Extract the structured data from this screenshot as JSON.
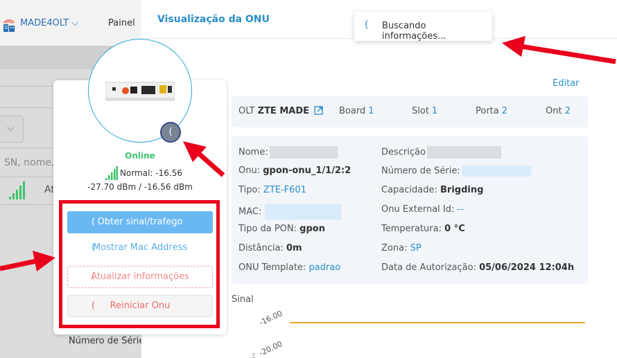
{
  "background": {
    "brand": "MADE4OLT",
    "brand_chevron": "⌵",
    "nav_painel": "Painel",
    "search_placeholder": "SN, nome,",
    "column_at": "At",
    "column_numero_serie": "Número de Série"
  },
  "drawer": {
    "title": "Visualização da ONU",
    "edit_link": "Editar",
    "olt": {
      "olt_label": "OLT",
      "olt_value": "ZTE MADE",
      "board_label": "Board",
      "board_value": "1",
      "slot_label": "Slot",
      "slot_value": "1",
      "porta_label": "Porta",
      "porta_value": "2",
      "ont_label": "Ont",
      "ont_value": "2"
    },
    "info_left": {
      "nome_label": "Nome:",
      "onu_label": "Onu:",
      "onu_value": "gpon-onu_1/1/2:2",
      "tipo_label": "Tipo:",
      "tipo_value": "ZTE-F601",
      "mac_label": "MAC:",
      "tipo_pon_label": "Tipo da PON:",
      "tipo_pon_value": "gpon",
      "distancia_label": "Distância:",
      "distancia_value": "0m",
      "template_label": "ONU Template:",
      "template_value": "padrao"
    },
    "info_right": {
      "descricao_label": "Descrição",
      "serie_label": "Número de Série:",
      "capacidade_label": "Capacidade:",
      "capacidade_value": "Brigding",
      "external_id_label": "Onu External Id:",
      "external_id_value": "--",
      "temperatura_label": "Temperatura:",
      "temperatura_value": "0 °C",
      "zona_label": "Zona:",
      "zona_value": "SP",
      "data_label": "Data de Autorização:",
      "data_value": "05/06/2024 12:04h"
    },
    "sinal_label": "Sinal",
    "chart_ticks": [
      "-16.00",
      "-20.00"
    ]
  },
  "toast": {
    "spinner": "(",
    "text": "Buscando informações..."
  },
  "onu_card": {
    "status": "Online",
    "signal_text": "Normal: -16.56",
    "dbm_text": "-27.70 dBm / -16.56 dBm",
    "spinner": "(",
    "buttons": {
      "obter": "Obter sinal/trafego",
      "mac": "Mostrar Mac Address",
      "atualizar": "Atualizar informações",
      "reiniciar": "Reiniciar Onu",
      "spinner": "("
    }
  },
  "colors": {
    "accent": "#2a8fc8",
    "online": "#3ec46d",
    "annotation_red": "#e8001c",
    "chart_line": "#f5a623",
    "chart_point": "#3aa3e3"
  },
  "icons": {
    "external_link": "external-link-icon",
    "signal": "signal-bars-icon",
    "logo": "building-logo-icon"
  }
}
